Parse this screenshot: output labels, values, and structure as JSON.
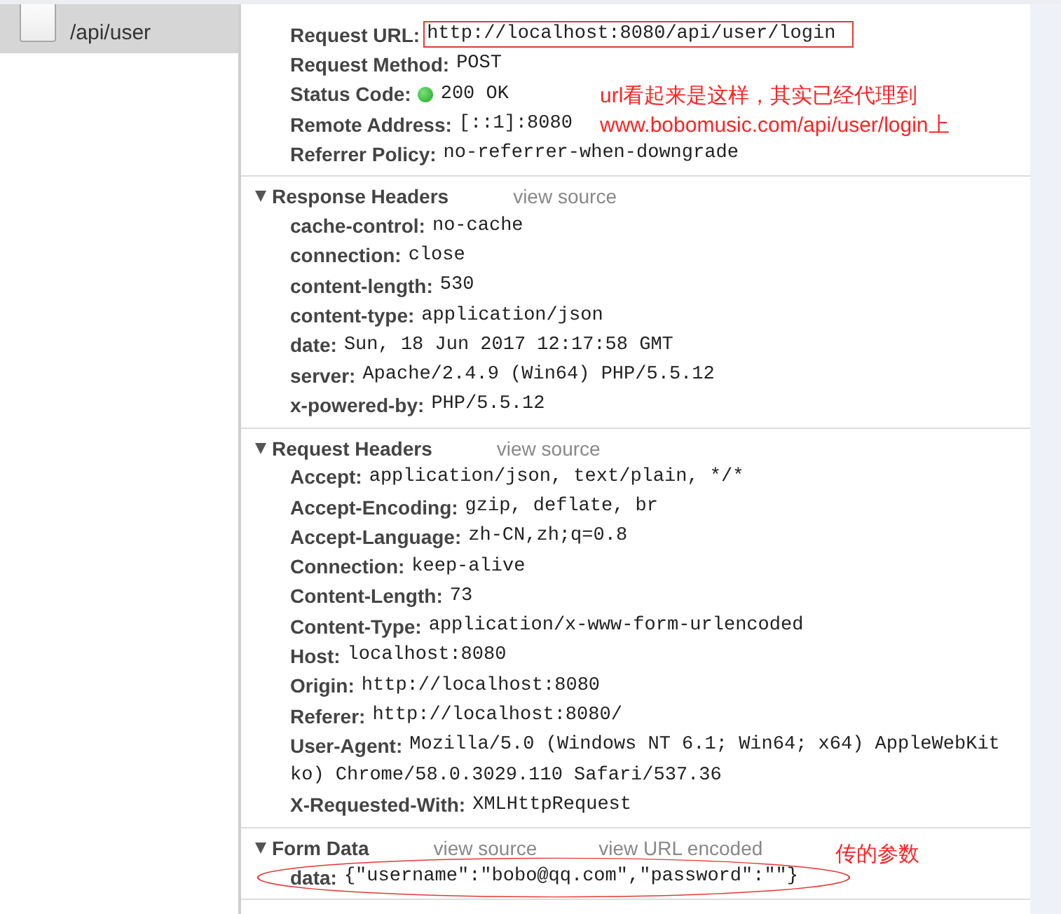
{
  "sidebar": {
    "items": [
      {
        "path": "/api/user",
        "selected": true
      }
    ]
  },
  "sections": [
    {
      "note": "url看起来是这样，其实已经代理到\nwww.bobomusic.com/api/user/login上",
      "rows": [
        {
          "name": "Request URL:",
          "value": "http://localhost:8080/api/user/login",
          "highlighted": true
        },
        {
          "name": "Request Method:",
          "value": "POST"
        },
        {
          "name": "Status Code:",
          "value": "200 OK",
          "kind": "status"
        },
        {
          "name": "Remote Address:",
          "value": "[::1]:8080"
        },
        {
          "name": "Referrer Policy:",
          "value": "no-referrer-when-downgrade"
        }
      ]
    },
    {
      "title": "Response Headers",
      "expanded": true,
      "links": [
        "view source"
      ],
      "rows": [
        {
          "name": "cache-control:",
          "value": "no-cache"
        },
        {
          "name": "connection:",
          "value": "close"
        },
        {
          "name": "content-length:",
          "value": "530"
        },
        {
          "name": "content-type:",
          "value": "application/json"
        },
        {
          "name": "date:",
          "value": "Sun, 18 Jun 2017 12:17:58 GMT"
        },
        {
          "name": "server:",
          "value": "Apache/2.4.9 (Win64) PHP/5.5.12"
        },
        {
          "name": "x-powered-by:",
          "value": "PHP/5.5.12"
        }
      ]
    },
    {
      "title": "Request Headers",
      "expanded": true,
      "links": [
        "view source"
      ],
      "rows": [
        {
          "name": "Accept:",
          "value": "application/json, text/plain, */*"
        },
        {
          "name": "Accept-Encoding:",
          "value": "gzip, deflate, br"
        },
        {
          "name": "Accept-Language:",
          "value": "zh-CN,zh;q=0.8"
        },
        {
          "name": "Connection:",
          "value": "keep-alive"
        },
        {
          "name": "Content-Length:",
          "value": "73"
        },
        {
          "name": "Content-Type:",
          "value": "application/x-www-form-urlencoded"
        },
        {
          "name": "Host:",
          "value": "localhost:8080"
        },
        {
          "name": "Origin:",
          "value": "http://localhost:8080"
        },
        {
          "name": "Referer:",
          "value": "http://localhost:8080/"
        },
        {
          "name": "User-Agent:",
          "value": "Mozilla/5.0 (Windows NT 6.1; Win64; x64) AppleWebKit",
          "wrapped_value": "ko) Chrome/58.0.3029.110 Safari/537.36"
        },
        {
          "name": "X-Requested-With:",
          "value": "XMLHttpRequest"
        }
      ]
    },
    {
      "title": "Form Data",
      "expanded": true,
      "links": [
        "view source",
        "view URL encoded"
      ],
      "note": "传的参数",
      "rows": [
        {
          "name": "data:",
          "value": "{\"username\":\"bobo@qq.com\",\"password\":\"\"}",
          "circled": true
        }
      ]
    }
  ]
}
